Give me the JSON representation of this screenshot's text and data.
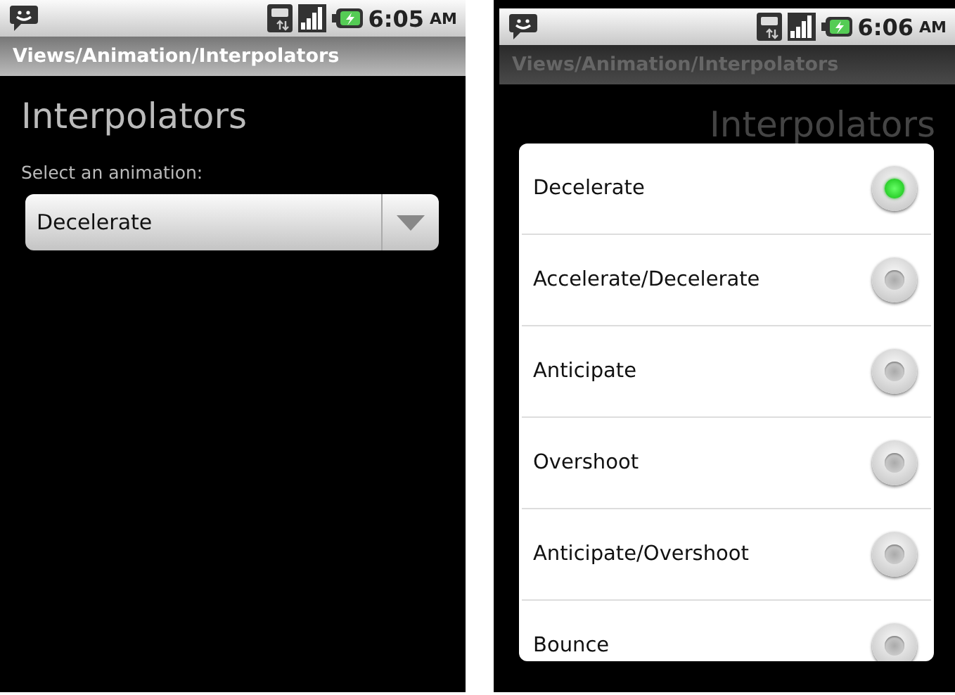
{
  "screens": [
    {
      "status_bar": {
        "time": "6:05",
        "meridiem": "AM"
      },
      "title_bar": "Views/Animation/Interpolators",
      "heading": "Interpolators",
      "label": "Select an animation:",
      "spinner": {
        "value": "Decelerate"
      },
      "dimmed": false
    },
    {
      "status_bar": {
        "time": "6:06",
        "meridiem": "AM"
      },
      "title_bar": "Views/Animation/Interpolators",
      "heading": "Interpolators",
      "dimmed": true,
      "dialog": {
        "options": [
          {
            "label": "Decelerate",
            "selected": true
          },
          {
            "label": "Accelerate/Decelerate",
            "selected": false
          },
          {
            "label": "Anticipate",
            "selected": false
          },
          {
            "label": "Overshoot",
            "selected": false
          },
          {
            "label": "Anticipate/Overshoot",
            "selected": false
          },
          {
            "label": "Bounce",
            "selected": false
          }
        ]
      }
    }
  ]
}
